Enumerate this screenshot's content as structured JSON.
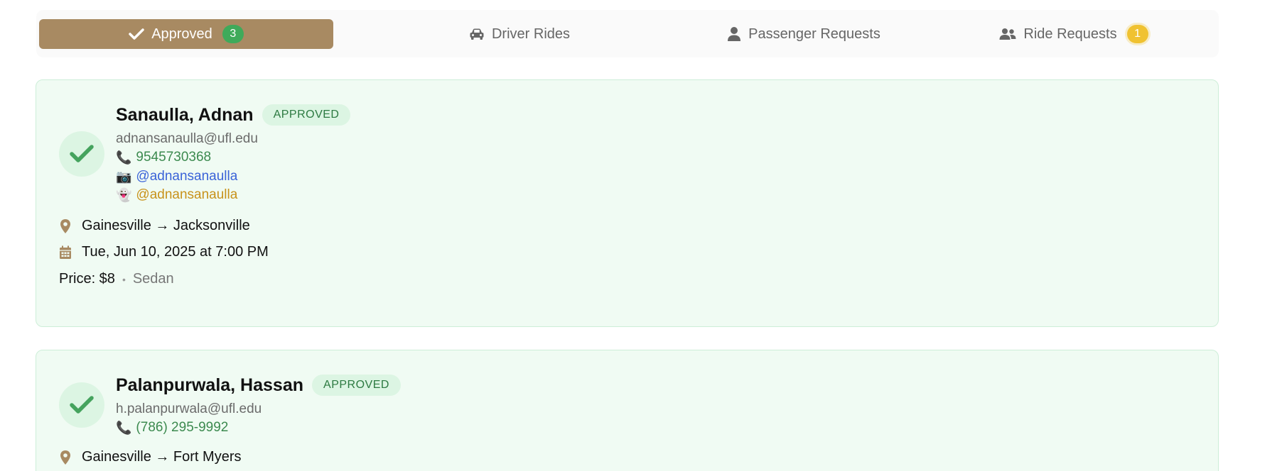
{
  "tabs": [
    {
      "label": "Approved",
      "badge": "3",
      "icon": "check-icon",
      "active": true
    },
    {
      "label": "Driver Rides",
      "icon": "car-icon"
    },
    {
      "label": "Passenger Requests",
      "icon": "user-icon"
    },
    {
      "label": "Ride Requests",
      "badge": "1",
      "icon": "users-icon"
    }
  ],
  "rides": [
    {
      "name": "Sanaulla, Adnan",
      "status": "APPROVED",
      "email": "adnansanaulla@ufl.edu",
      "phone": "9545730368",
      "instagram": "@adnansanaulla",
      "snapchat": "@adnansanaulla",
      "route": "Gainesville → Jacksonville",
      "datetime": "Tue, Jun 10, 2025 at 7:00 PM",
      "price": "Price: $8",
      "vehicle": "Sedan"
    },
    {
      "name": "Palanpurwala, Hassan",
      "status": "APPROVED",
      "email": "h.palanpurwala@ufl.edu",
      "phone": "(786) 295-9992",
      "route": "Gainesville → Fort Myers"
    }
  ],
  "colors": {
    "accent": "#a88a62",
    "approved_bg": "#f0fbf3",
    "approved_text": "#2c7a41",
    "badge_green": "#3faa5a",
    "badge_yellow": "#f0c231"
  }
}
